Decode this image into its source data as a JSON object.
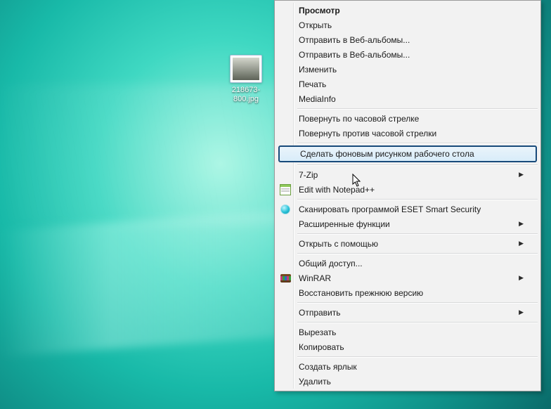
{
  "desktop_file": {
    "name": "218673-800.jpg"
  },
  "menu": {
    "items": [
      {
        "label": "Просмотр",
        "bold": true
      },
      {
        "label": "Открыть"
      },
      {
        "label": "Отправить в Веб-альбомы..."
      },
      {
        "label": "Отправить в Веб-альбомы..."
      },
      {
        "label": "Изменить"
      },
      {
        "label": "Печать"
      },
      {
        "label": "MediaInfo"
      },
      {
        "sep": true
      },
      {
        "label": "Повернуть по часовой стрелке"
      },
      {
        "label": "Повернуть против часовой стрелки"
      },
      {
        "sep": true
      },
      {
        "label": "Сделать фоновым рисунком рабочего стола",
        "highlight": true
      },
      {
        "sep": true
      },
      {
        "label": "7-Zip",
        "submenu": true
      },
      {
        "label": "Edit with Notepad++",
        "icon": "notepad-icon"
      },
      {
        "sep": true
      },
      {
        "label": "Сканировать программой ESET Smart Security",
        "icon": "eset-icon"
      },
      {
        "label": "Расширенные функции",
        "submenu": true
      },
      {
        "sep": true
      },
      {
        "label": "Открыть с помощью",
        "submenu": true
      },
      {
        "sep": true
      },
      {
        "label": "Общий доступ..."
      },
      {
        "label": "WinRAR",
        "submenu": true,
        "icon": "winrar-icon"
      },
      {
        "label": "Восстановить прежнюю версию"
      },
      {
        "sep": true
      },
      {
        "label": "Отправить",
        "submenu": true
      },
      {
        "sep": true
      },
      {
        "label": "Вырезать"
      },
      {
        "label": "Копировать"
      },
      {
        "sep": true
      },
      {
        "label": "Создать ярлык"
      },
      {
        "label": "Удалить"
      }
    ]
  }
}
